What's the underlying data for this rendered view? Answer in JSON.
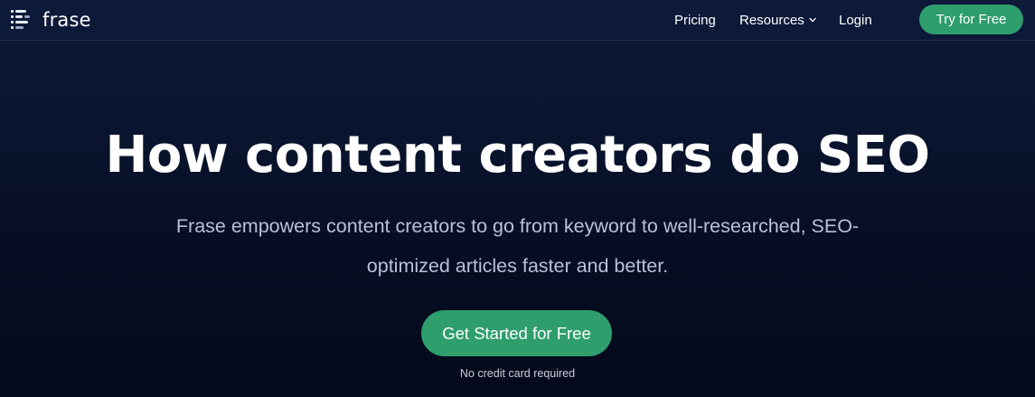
{
  "brand": {
    "name": "frase",
    "logo_icon": "frase-logo-icon"
  },
  "nav": {
    "links": [
      {
        "label": "Pricing"
      },
      {
        "label": "Resources",
        "has_dropdown": true
      },
      {
        "label": "Login"
      }
    ],
    "cta_label": "Try for Free"
  },
  "hero": {
    "title": "How content creators do SEO",
    "subtitle": "Frase empowers content creators to go from keyword to well-researched, SEO-optimized articles faster and better.",
    "cta_label": "Get Started for Free",
    "cta_note": "No credit card required"
  },
  "colors": {
    "background_top": "#0d1a3a",
    "background_bottom": "#040a1b",
    "accent_green": "#2e9e6d",
    "subtitle_text": "#b9c1d6"
  }
}
